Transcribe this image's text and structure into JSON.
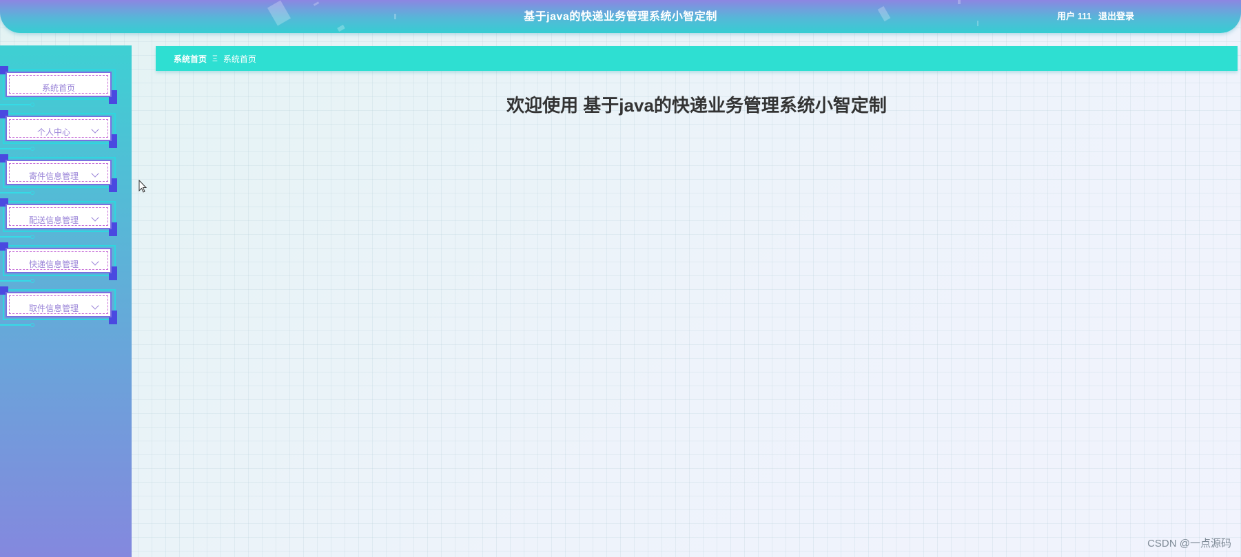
{
  "header": {
    "title": "基于java的快递业务管理系统小智定制",
    "user_label": "用户 111",
    "logout_label": "退出登录"
  },
  "sidebar": {
    "items": [
      {
        "label": "系统首页",
        "has_chevron": false
      },
      {
        "label": "个人中心",
        "has_chevron": true
      },
      {
        "label": "寄件信息管理",
        "has_chevron": true
      },
      {
        "label": "配送信息管理",
        "has_chevron": true
      },
      {
        "label": "快递信息管理",
        "has_chevron": true
      },
      {
        "label": "取件信息管理",
        "has_chevron": true
      }
    ]
  },
  "breadcrumb": {
    "home": "系统首页",
    "separator": "Ξ",
    "current": "系统首页"
  },
  "main": {
    "welcome": "欢迎使用 基于java的快递业务管理系统小智定制"
  },
  "watermark": "CSDN @一点源码",
  "colors": {
    "header_gradient_top": "#8c86e2",
    "header_gradient_bottom": "#36cdd2",
    "breadcrumb_bg": "#2edfd2",
    "sidebar_top": "#3ed0d3",
    "sidebar_bottom": "#8488de",
    "menu_text": "#9a84d8"
  }
}
